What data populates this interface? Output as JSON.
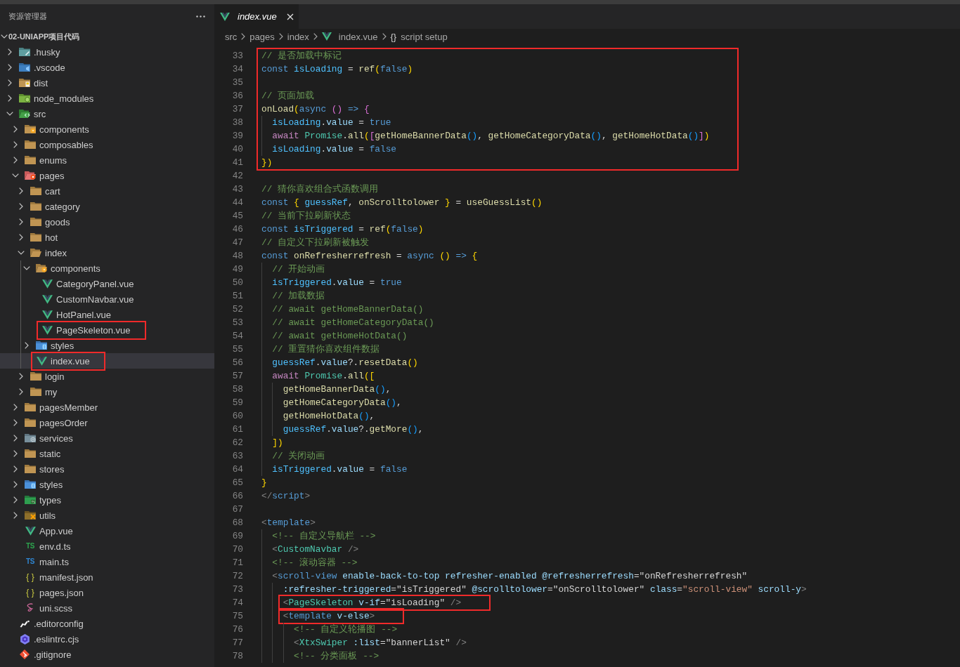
{
  "explorer": {
    "title": "资源管理器",
    "root": {
      "name": "02-UNIAPP项目代码",
      "expanded": true,
      "children": [
        {
          "name": ".husky",
          "kind": "husky",
          "expanded": false,
          "selected": false,
          "highlighted": false
        },
        {
          "name": ".vscode",
          "kind": "vscode",
          "expanded": false,
          "selected": false,
          "highlighted": false
        },
        {
          "name": "dist",
          "kind": "dist",
          "expanded": false,
          "selected": false,
          "highlighted": false
        },
        {
          "name": "node_modules",
          "kind": "node",
          "expanded": false,
          "selected": false,
          "highlighted": false
        },
        {
          "name": "src",
          "kind": "src",
          "expanded": true,
          "selected": false,
          "highlighted": false,
          "children": [
            {
              "name": "components",
              "kind": "components",
              "expanded": false,
              "selected": false,
              "highlighted": false
            },
            {
              "name": "composables",
              "kind": "folder",
              "expanded": false,
              "selected": false,
              "highlighted": false
            },
            {
              "name": "enums",
              "kind": "folder",
              "expanded": false,
              "selected": false,
              "highlighted": false
            },
            {
              "name": "pages",
              "kind": "pages",
              "expanded": true,
              "selected": false,
              "highlighted": false,
              "children": [
                {
                  "name": "cart",
                  "kind": "folder",
                  "expanded": false,
                  "selected": false,
                  "highlighted": false
                },
                {
                  "name": "category",
                  "kind": "folder",
                  "expanded": false,
                  "selected": false,
                  "highlighted": false
                },
                {
                  "name": "goods",
                  "kind": "folder",
                  "expanded": false,
                  "selected": false,
                  "highlighted": false
                },
                {
                  "name": "hot",
                  "kind": "folder",
                  "expanded": false,
                  "selected": false,
                  "highlighted": false
                },
                {
                  "name": "index",
                  "kind": "folder",
                  "expanded": true,
                  "selected": false,
                  "highlighted": false,
                  "children": [
                    {
                      "name": "components",
                      "kind": "components",
                      "expanded": true,
                      "selected": false,
                      "highlighted": false,
                      "children": [
                        {
                          "name": "CategoryPanel.vue",
                          "kind": "vue",
                          "selected": false,
                          "highlighted": false
                        },
                        {
                          "name": "CustomNavbar.vue",
                          "kind": "vue",
                          "selected": false,
                          "highlighted": false
                        },
                        {
                          "name": "HotPanel.vue",
                          "kind": "vue",
                          "selected": false,
                          "highlighted": false
                        },
                        {
                          "name": "PageSkeleton.vue",
                          "kind": "vue",
                          "selected": false,
                          "highlighted": true
                        }
                      ]
                    },
                    {
                      "name": "styles",
                      "kind": "styles",
                      "expanded": false,
                      "selected": false,
                      "highlighted": false
                    },
                    {
                      "name": "index.vue",
                      "kind": "vue",
                      "selected": true,
                      "highlighted": true
                    }
                  ]
                },
                {
                  "name": "login",
                  "kind": "folder",
                  "expanded": false,
                  "selected": false,
                  "highlighted": false
                },
                {
                  "name": "my",
                  "kind": "folder",
                  "expanded": false,
                  "selected": false,
                  "highlighted": false
                }
              ]
            },
            {
              "name": "pagesMember",
              "kind": "folder",
              "expanded": false,
              "selected": false,
              "highlighted": false
            },
            {
              "name": "pagesOrder",
              "kind": "folder",
              "expanded": false,
              "selected": false,
              "highlighted": false
            },
            {
              "name": "services",
              "kind": "services",
              "expanded": false,
              "selected": false,
              "highlighted": false
            },
            {
              "name": "static",
              "kind": "folder",
              "expanded": false,
              "selected": false,
              "highlighted": false
            },
            {
              "name": "stores",
              "kind": "folder",
              "expanded": false,
              "selected": false,
              "highlighted": false
            },
            {
              "name": "styles",
              "kind": "styles",
              "expanded": false,
              "selected": false,
              "highlighted": false
            },
            {
              "name": "types",
              "kind": "types",
              "expanded": false,
              "selected": false,
              "highlighted": false
            },
            {
              "name": "utils",
              "kind": "utils",
              "expanded": false,
              "selected": false,
              "highlighted": false
            },
            {
              "name": "App.vue",
              "kind": "vue",
              "selected": false,
              "highlighted": false
            },
            {
              "name": "env.d.ts",
              "kind": "dts",
              "icon_text": "TS",
              "selected": false,
              "highlighted": false
            },
            {
              "name": "main.ts",
              "kind": "ts",
              "icon_text": "TS",
              "selected": false,
              "highlighted": false
            },
            {
              "name": "manifest.json",
              "kind": "json",
              "icon_text": "{ }",
              "selected": false,
              "highlighted": false
            },
            {
              "name": "pages.json",
              "kind": "json",
              "icon_text": "{ }",
              "selected": false,
              "highlighted": false
            },
            {
              "name": "uni.scss",
              "kind": "scss",
              "selected": false,
              "highlighted": false
            }
          ]
        },
        {
          "name": ".editorconfig",
          "kind": "editorconfig",
          "selected": false,
          "highlighted": false
        },
        {
          "name": ".eslintrc.cjs",
          "kind": "eslint",
          "selected": false,
          "highlighted": false
        },
        {
          "name": ".gitignore",
          "kind": "git",
          "selected": false,
          "highlighted": false
        }
      ]
    }
  },
  "editor": {
    "tabs": [
      {
        "label": "index.vue",
        "kind": "vue",
        "selected": true,
        "preview": true
      }
    ],
    "breadcrumb": [
      {
        "kind": "folder",
        "label": "src"
      },
      {
        "kind": "folder",
        "label": "pages"
      },
      {
        "kind": "folder",
        "label": "index"
      },
      {
        "kind": "vue",
        "label": "index.vue"
      },
      {
        "kind": "symbol",
        "symbol": "{}",
        "label": "script setup"
      }
    ],
    "blocks": [
      {
        "boxed": true,
        "lines": [
          {
            "number": "33",
            "tokens": [
              {
                "kind": "comment",
                "text": "// 是否加载中标记"
              }
            ]
          },
          {
            "number": "34",
            "tokens": [
              {
                "kind": "keyword",
                "text": "const "
              },
              {
                "kind": "constant",
                "text": "isLoading"
              },
              {
                "kind": "plain",
                "text": " = "
              },
              {
                "kind": "function",
                "text": "ref"
              },
              {
                "kind": "bracket1",
                "text": "("
              },
              {
                "kind": "keyword",
                "text": "false"
              },
              {
                "kind": "bracket1",
                "text": ")"
              }
            ]
          },
          {
            "number": "35"
          },
          {
            "number": "36",
            "tokens": [
              {
                "kind": "comment",
                "text": "// 页面加载"
              }
            ]
          },
          {
            "number": "37",
            "tokens": [
              {
                "kind": "function",
                "text": "onLoad"
              },
              {
                "kind": "bracket1",
                "text": "("
              },
              {
                "kind": "keyword",
                "text": "async "
              },
              {
                "kind": "bracket2",
                "text": "() "
              },
              {
                "kind": "keyword",
                "text": "=> "
              },
              {
                "kind": "bracket2",
                "text": "{"
              }
            ]
          },
          {
            "number": "38",
            "tokens": [
              {
                "kind": "constant",
                "text": "  isLoading"
              },
              {
                "kind": "plain",
                "text": "."
              },
              {
                "kind": "variable",
                "text": "value"
              },
              {
                "kind": "plain",
                "text": " = "
              },
              {
                "kind": "keyword",
                "text": "true"
              }
            ]
          },
          {
            "number": "39",
            "tokens": [
              {
                "kind": "control",
                "text": "  await "
              },
              {
                "kind": "type",
                "text": "Promise"
              },
              {
                "kind": "plain",
                "text": "."
              },
              {
                "kind": "function",
                "text": "all"
              },
              {
                "kind": "bracket1",
                "text": "("
              },
              {
                "kind": "bracket2",
                "text": "["
              },
              {
                "kind": "function",
                "text": "getHomeBannerData"
              },
              {
                "kind": "bracket3",
                "text": "()"
              },
              {
                "kind": "plain",
                "text": ", "
              },
              {
                "kind": "function",
                "text": "getHomeCategoryData"
              },
              {
                "kind": "bracket3",
                "text": "()"
              },
              {
                "kind": "plain",
                "text": ", "
              },
              {
                "kind": "function",
                "text": "getHomeHotData"
              },
              {
                "kind": "bracket3",
                "text": "()"
              },
              {
                "kind": "bracket2",
                "text": "]"
              },
              {
                "kind": "bracket1",
                "text": ")"
              }
            ]
          },
          {
            "number": "40",
            "tokens": [
              {
                "kind": "constant",
                "text": "  isLoading"
              },
              {
                "kind": "plain",
                "text": "."
              },
              {
                "kind": "variable",
                "text": "value"
              },
              {
                "kind": "plain",
                "text": " = "
              },
              {
                "kind": "keyword",
                "text": "false"
              }
            ]
          },
          {
            "number": "41",
            "tokens": [
              {
                "kind": "bracket1",
                "text": "})"
              }
            ]
          }
        ]
      },
      {
        "boxed": false,
        "lines": [
          {
            "number": "42"
          },
          {
            "number": "43",
            "tokens": [
              {
                "kind": "comment",
                "text": "// 猜你喜欢组合式函数调用"
              }
            ]
          },
          {
            "number": "44",
            "tokens": [
              {
                "kind": "keyword",
                "text": "const "
              },
              {
                "kind": "bracket1",
                "text": "{ "
              },
              {
                "kind": "constant",
                "text": "guessRef"
              },
              {
                "kind": "plain",
                "text": ", "
              },
              {
                "kind": "function",
                "text": "onScrolltolower "
              },
              {
                "kind": "bracket1",
                "text": "}"
              },
              {
                "kind": "plain",
                "text": " = "
              },
              {
                "kind": "function",
                "text": "useGuessList"
              },
              {
                "kind": "bracket1",
                "text": "()"
              }
            ]
          },
          {
            "number": "45",
            "tokens": [
              {
                "kind": "comment",
                "text": "// 当前下拉刷新状态"
              }
            ]
          },
          {
            "number": "46",
            "tokens": [
              {
                "kind": "keyword",
                "text": "const "
              },
              {
                "kind": "constant",
                "text": "isTriggered"
              },
              {
                "kind": "plain",
                "text": " = "
              },
              {
                "kind": "function",
                "text": "ref"
              },
              {
                "kind": "bracket1",
                "text": "("
              },
              {
                "kind": "keyword",
                "text": "false"
              },
              {
                "kind": "bracket1",
                "text": ")"
              }
            ]
          },
          {
            "number": "47",
            "tokens": [
              {
                "kind": "comment",
                "text": "// 自定义下拉刷新被触发"
              }
            ]
          },
          {
            "number": "48",
            "tokens": [
              {
                "kind": "keyword",
                "text": "const "
              },
              {
                "kind": "function",
                "text": "onRefresherrefresh"
              },
              {
                "kind": "plain",
                "text": " = "
              },
              {
                "kind": "keyword",
                "text": "async "
              },
              {
                "kind": "bracket1",
                "text": "() "
              },
              {
                "kind": "keyword",
                "text": "=> "
              },
              {
                "kind": "bracket1",
                "text": "{"
              }
            ]
          },
          {
            "number": "49",
            "tokens": [
              {
                "kind": "comment",
                "text": "  // 开始动画"
              }
            ]
          },
          {
            "number": "50",
            "tokens": [
              {
                "kind": "constant",
                "text": "  isTriggered"
              },
              {
                "kind": "plain",
                "text": "."
              },
              {
                "kind": "variable",
                "text": "value"
              },
              {
                "kind": "plain",
                "text": " = "
              },
              {
                "kind": "keyword",
                "text": "true"
              }
            ]
          },
          {
            "number": "51",
            "tokens": [
              {
                "kind": "comment",
                "text": "  // 加载数据"
              }
            ]
          },
          {
            "number": "52",
            "tokens": [
              {
                "kind": "comment",
                "text": "  // await getHomeBannerData()"
              }
            ]
          },
          {
            "number": "53",
            "tokens": [
              {
                "kind": "comment",
                "text": "  // await getHomeCategoryData()"
              }
            ]
          },
          {
            "number": "54",
            "tokens": [
              {
                "kind": "comment",
                "text": "  // await getHomeHotData()"
              }
            ]
          },
          {
            "number": "55",
            "tokens": [
              {
                "kind": "comment",
                "text": "  // 重置猜你喜欢组件数据"
              }
            ]
          },
          {
            "number": "56",
            "tokens": [
              {
                "kind": "constant",
                "text": "  guessRef"
              },
              {
                "kind": "plain",
                "text": "."
              },
              {
                "kind": "variable",
                "text": "value"
              },
              {
                "kind": "plain",
                "text": "?."
              },
              {
                "kind": "function",
                "text": "resetData"
              },
              {
                "kind": "bracket1",
                "text": "()"
              }
            ]
          },
          {
            "number": "57",
            "tokens": [
              {
                "kind": "control",
                "text": "  await "
              },
              {
                "kind": "type",
                "text": "Promise"
              },
              {
                "kind": "plain",
                "text": "."
              },
              {
                "kind": "function",
                "text": "all"
              },
              {
                "kind": "bracket1",
                "text": "(["
              }
            ]
          },
          {
            "number": "58",
            "tokens": [
              {
                "kind": "function",
                "text": "    getHomeBannerData"
              },
              {
                "kind": "bracket3",
                "text": "()"
              },
              {
                "kind": "plain",
                "text": ","
              }
            ]
          },
          {
            "number": "59",
            "tokens": [
              {
                "kind": "function",
                "text": "    getHomeCategoryData"
              },
              {
                "kind": "bracket3",
                "text": "()"
              },
              {
                "kind": "plain",
                "text": ","
              }
            ]
          },
          {
            "number": "60",
            "tokens": [
              {
                "kind": "function",
                "text": "    getHomeHotData"
              },
              {
                "kind": "bracket3",
                "text": "()"
              },
              {
                "kind": "plain",
                "text": ","
              }
            ]
          },
          {
            "number": "61",
            "tokens": [
              {
                "kind": "constant",
                "text": "    guessRef"
              },
              {
                "kind": "plain",
                "text": "."
              },
              {
                "kind": "variable",
                "text": "value"
              },
              {
                "kind": "plain",
                "text": "?."
              },
              {
                "kind": "function",
                "text": "getMore"
              },
              {
                "kind": "bracket3",
                "text": "()"
              },
              {
                "kind": "plain",
                "text": ","
              }
            ]
          },
          {
            "number": "62",
            "tokens": [
              {
                "kind": "bracket1",
                "text": "  ])"
              }
            ]
          },
          {
            "number": "63",
            "tokens": [
              {
                "kind": "comment",
                "text": "  // 关闭动画"
              }
            ]
          },
          {
            "number": "64",
            "tokens": [
              {
                "kind": "constant",
                "text": "  isTriggered"
              },
              {
                "kind": "plain",
                "text": "."
              },
              {
                "kind": "variable",
                "text": "value"
              },
              {
                "kind": "plain",
                "text": " = "
              },
              {
                "kind": "keyword",
                "text": "false"
              }
            ]
          },
          {
            "number": "65",
            "tokens": [
              {
                "kind": "bracket1",
                "text": "}"
              }
            ]
          },
          {
            "number": "66",
            "tokens": [
              {
                "kind": "tag",
                "text": "</"
              },
              {
                "kind": "keyword",
                "text": "script"
              },
              {
                "kind": "tag",
                "text": ">"
              }
            ]
          },
          {
            "number": "67"
          },
          {
            "number": "68",
            "tokens": [
              {
                "kind": "tag",
                "text": "<"
              },
              {
                "kind": "keyword",
                "text": "template"
              },
              {
                "kind": "tag",
                "text": ">"
              }
            ]
          },
          {
            "number": "69",
            "tokens": [
              {
                "kind": "comment",
                "text": "  <!-- 自定义导航栏 -->"
              }
            ]
          },
          {
            "number": "70",
            "tokens": [
              {
                "kind": "tag",
                "text": "  <"
              },
              {
                "kind": "type",
                "text": "CustomNavbar"
              },
              {
                "kind": "tag",
                "text": " />"
              }
            ]
          },
          {
            "number": "71",
            "tokens": [
              {
                "kind": "comment",
                "text": "  <!-- 滚动容器 -->"
              }
            ]
          },
          {
            "number": "72",
            "tokens": [
              {
                "kind": "tag",
                "text": "  <"
              },
              {
                "kind": "keyword",
                "text": "scroll-view"
              },
              {
                "kind": "variable",
                "text": " enable-back-to-top refresher-enabled @refresherrefresh"
              },
              {
                "kind": "plain",
                "text": "=\"onRefresherrefresh\""
              }
            ]
          },
          {
            "number": "73",
            "tokens": [
              {
                "kind": "variable",
                "text": "    :refresher-triggered"
              },
              {
                "kind": "plain",
                "text": "=\"isTriggered\" "
              },
              {
                "kind": "variable",
                "text": "@scrolltolower"
              },
              {
                "kind": "plain",
                "text": "=\"onScrolltolower\" "
              },
              {
                "kind": "variable",
                "text": "class"
              },
              {
                "kind": "plain",
                "text": "="
              },
              {
                "kind": "string",
                "text": "\"scroll-view\""
              },
              {
                "kind": "variable",
                "text": " scroll-y"
              },
              {
                "kind": "tag",
                "text": ">"
              }
            ]
          }
        ]
      },
      {
        "boxed": true,
        "lines": [
          {
            "number": "74",
            "tokens": [
              {
                "kind": "tag",
                "text": "    <"
              },
              {
                "kind": "type",
                "text": "PageSkeleton"
              },
              {
                "kind": "variable",
                "text": " v-if"
              },
              {
                "kind": "plain",
                "text": "=\"isLoading\" "
              },
              {
                "kind": "tag",
                "text": "/>"
              }
            ]
          }
        ]
      },
      {
        "boxed": true,
        "lines": [
          {
            "number": "75",
            "tokens": [
              {
                "kind": "tag",
                "text": "    <"
              },
              {
                "kind": "keyword",
                "text": "template"
              },
              {
                "kind": "variable",
                "text": " v-else"
              },
              {
                "kind": "tag",
                "text": ">"
              }
            ]
          }
        ]
      },
      {
        "boxed": false,
        "lines": [
          {
            "number": "76",
            "tokens": [
              {
                "kind": "comment",
                "text": "      <!-- 自定义轮播图 -->"
              }
            ]
          },
          {
            "number": "77",
            "tokens": [
              {
                "kind": "tag",
                "text": "      <"
              },
              {
                "kind": "type",
                "text": "XtxSwiper"
              },
              {
                "kind": "variable",
                "text": " :list"
              },
              {
                "kind": "plain",
                "text": "=\"bannerList\" "
              },
              {
                "kind": "tag",
                "text": "/>"
              }
            ]
          },
          {
            "number": "78",
            "tokens": [
              {
                "kind": "comment",
                "text": "      <!-- 分类面板 -->"
              }
            ]
          }
        ]
      }
    ]
  }
}
